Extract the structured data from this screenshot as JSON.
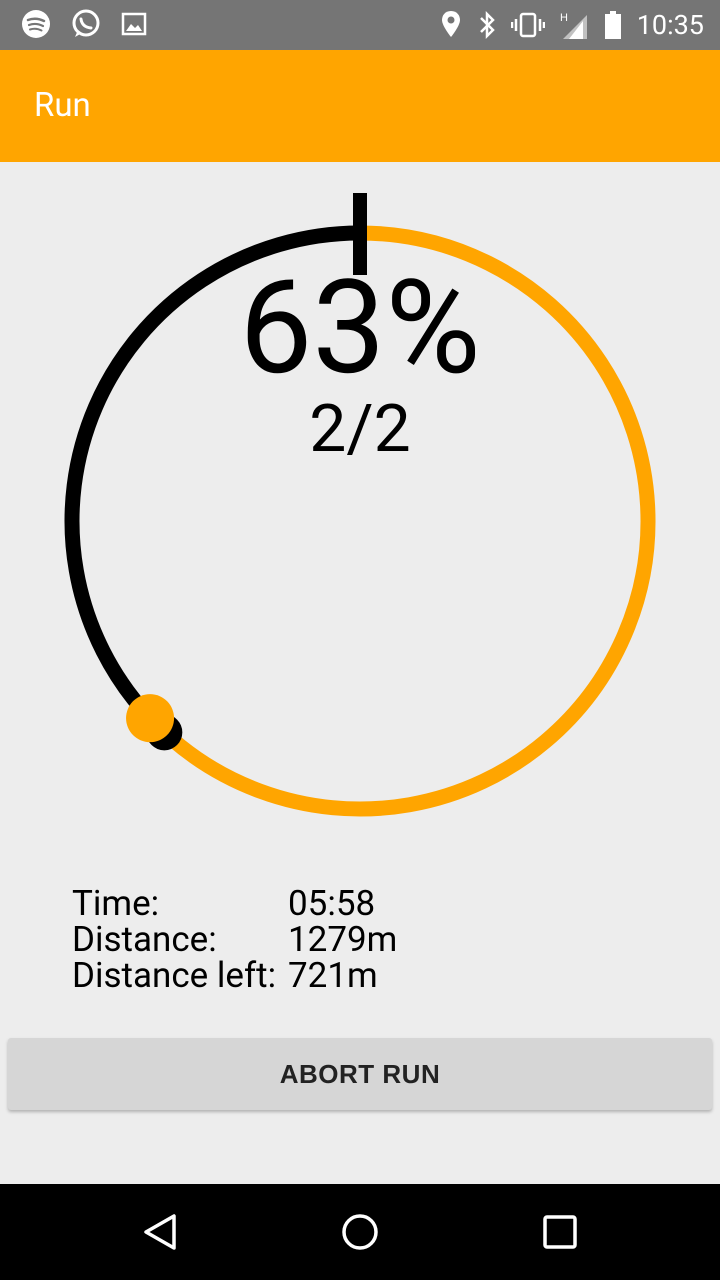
{
  "status_bar": {
    "time": "10:35",
    "left_icons": [
      "spotify-icon",
      "whatsapp-icon",
      "gallery-icon"
    ],
    "right_icons": [
      "location-icon",
      "bluetooth-icon",
      "vibrate-icon",
      "signal-icon",
      "battery-icon"
    ]
  },
  "app_bar": {
    "title": "Run"
  },
  "progress": {
    "percent_text": "63%",
    "lap_text": "2/2",
    "completed_fraction": 0.63,
    "remaining_color": "#000000",
    "completed_color": "#FFA500"
  },
  "stats": [
    {
      "label": "Time:",
      "value": "05:58"
    },
    {
      "label": "Distance:",
      "value": "1279m"
    },
    {
      "label": "Distance left:",
      "value": "721m"
    }
  ],
  "abort_button": {
    "label": "ABORT RUN"
  },
  "nav_bar": {
    "buttons": [
      "back-icon",
      "home-icon",
      "recents-icon"
    ]
  },
  "colors": {
    "accent": "#FFA500",
    "background": "#EDEDED",
    "status_bar": "#757575"
  }
}
